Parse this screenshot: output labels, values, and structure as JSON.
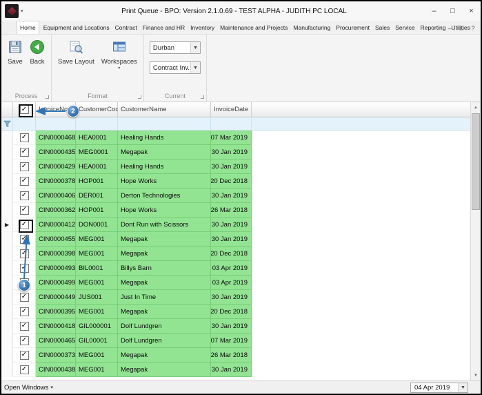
{
  "window": {
    "title": "Print Queue - BPO: Version 2.1.0.69 - TEST ALPHA - JUDITH PC LOCAL"
  },
  "titlebar_controls": {
    "minimize": "–",
    "maximize": "□",
    "close": "×"
  },
  "ribbon_window_controls": {
    "minimize": "–",
    "restore": "□",
    "help": "?"
  },
  "tabs": [
    "Home",
    "Equipment and Locations",
    "Contract",
    "Finance and HR",
    "Inventory",
    "Maintenance and Projects",
    "Manufacturing",
    "Procurement",
    "Sales",
    "Service",
    "Reporting",
    "Utilities"
  ],
  "active_tab": "Home",
  "ribbon": {
    "save_label": "Save",
    "back_label": "Back",
    "save_layout_label": "Save Layout",
    "workspaces_label": "Workspaces",
    "current_site": "Durban",
    "current_queue": "Contract Inv...",
    "group_process": "Process",
    "group_format": "Format",
    "group_current": "Current"
  },
  "grid": {
    "columns": [
      "InvoiceNo",
      "CustomerCode",
      "CustomerName",
      "InvoiceDate"
    ],
    "select_all_checked": true,
    "rows": [
      {
        "checked": true,
        "cells": [
          "CIN0000468",
          "HEA0001",
          "Healing Hands",
          "07 Mar 2019"
        ]
      },
      {
        "checked": true,
        "cells": [
          "CIN0000435",
          "MEG0001",
          "Megapak",
          "30 Jan 2019"
        ]
      },
      {
        "checked": true,
        "cells": [
          "CIN0000429",
          "HEA0001",
          "Healing Hands",
          "30 Jan 2019"
        ]
      },
      {
        "checked": true,
        "cells": [
          "CIN0000378",
          "HOP001",
          "Hope Works",
          "20 Dec 2018"
        ]
      },
      {
        "checked": true,
        "cells": [
          "CIN0000406",
          "DER001",
          "Derton Technologies",
          "30 Jan 2019"
        ]
      },
      {
        "checked": true,
        "cells": [
          "CIN0000362",
          "HOP001",
          "Hope Works",
          "26 Mar 2018"
        ]
      },
      {
        "checked": true,
        "current": true,
        "cells": [
          "CIN0000412",
          "DON0001",
          "Dont Run with Scissors",
          "30 Jan 2019"
        ]
      },
      {
        "checked": true,
        "cells": [
          "CIN0000455",
          "MEG001",
          "Megapak",
          "30 Jan 2019"
        ]
      },
      {
        "checked": true,
        "cells": [
          "CIN0000398",
          "MEG001",
          "Megapak",
          "20 Dec 2018"
        ]
      },
      {
        "checked": true,
        "cells": [
          "CIN0000493",
          "BIL0001",
          "Billys Barn",
          "03 Apr 2019"
        ]
      },
      {
        "checked": true,
        "cells": [
          "CIN0000499",
          "MEG001",
          "Megapak",
          "03 Apr 2019"
        ]
      },
      {
        "checked": true,
        "cells": [
          "CIN0000449",
          "JUS001",
          "Just In Time",
          "30 Jan 2019"
        ]
      },
      {
        "checked": true,
        "cells": [
          "CIN0000395",
          "MEG001",
          "Megapak",
          "20 Dec 2018"
        ]
      },
      {
        "checked": true,
        "cells": [
          "CIN0000418",
          "GIL000001",
          "Dolf Lundgren",
          "30 Jan 2019"
        ]
      },
      {
        "checked": true,
        "cells": [
          "CIN0000465",
          "GIL00001",
          "Dolf Lundgren",
          "07 Mar 2019"
        ]
      },
      {
        "checked": true,
        "cells": [
          "CIN0000373",
          "MEG001",
          "Megapak",
          "26 Mar 2018"
        ]
      },
      {
        "checked": true,
        "cells": [
          "CIN0000438",
          "MEG001",
          "Megapak",
          "30 Jan 2019"
        ]
      }
    ]
  },
  "statusbar": {
    "open_windows_label": "Open Windows",
    "date_value": "04 Apr 2019"
  },
  "annotations": {
    "callout_1": "1",
    "callout_2": "2"
  },
  "colors": {
    "row_green": "#92e492",
    "filter_blue": "#e4f2fc",
    "callout_blue": "#3a77b5"
  }
}
